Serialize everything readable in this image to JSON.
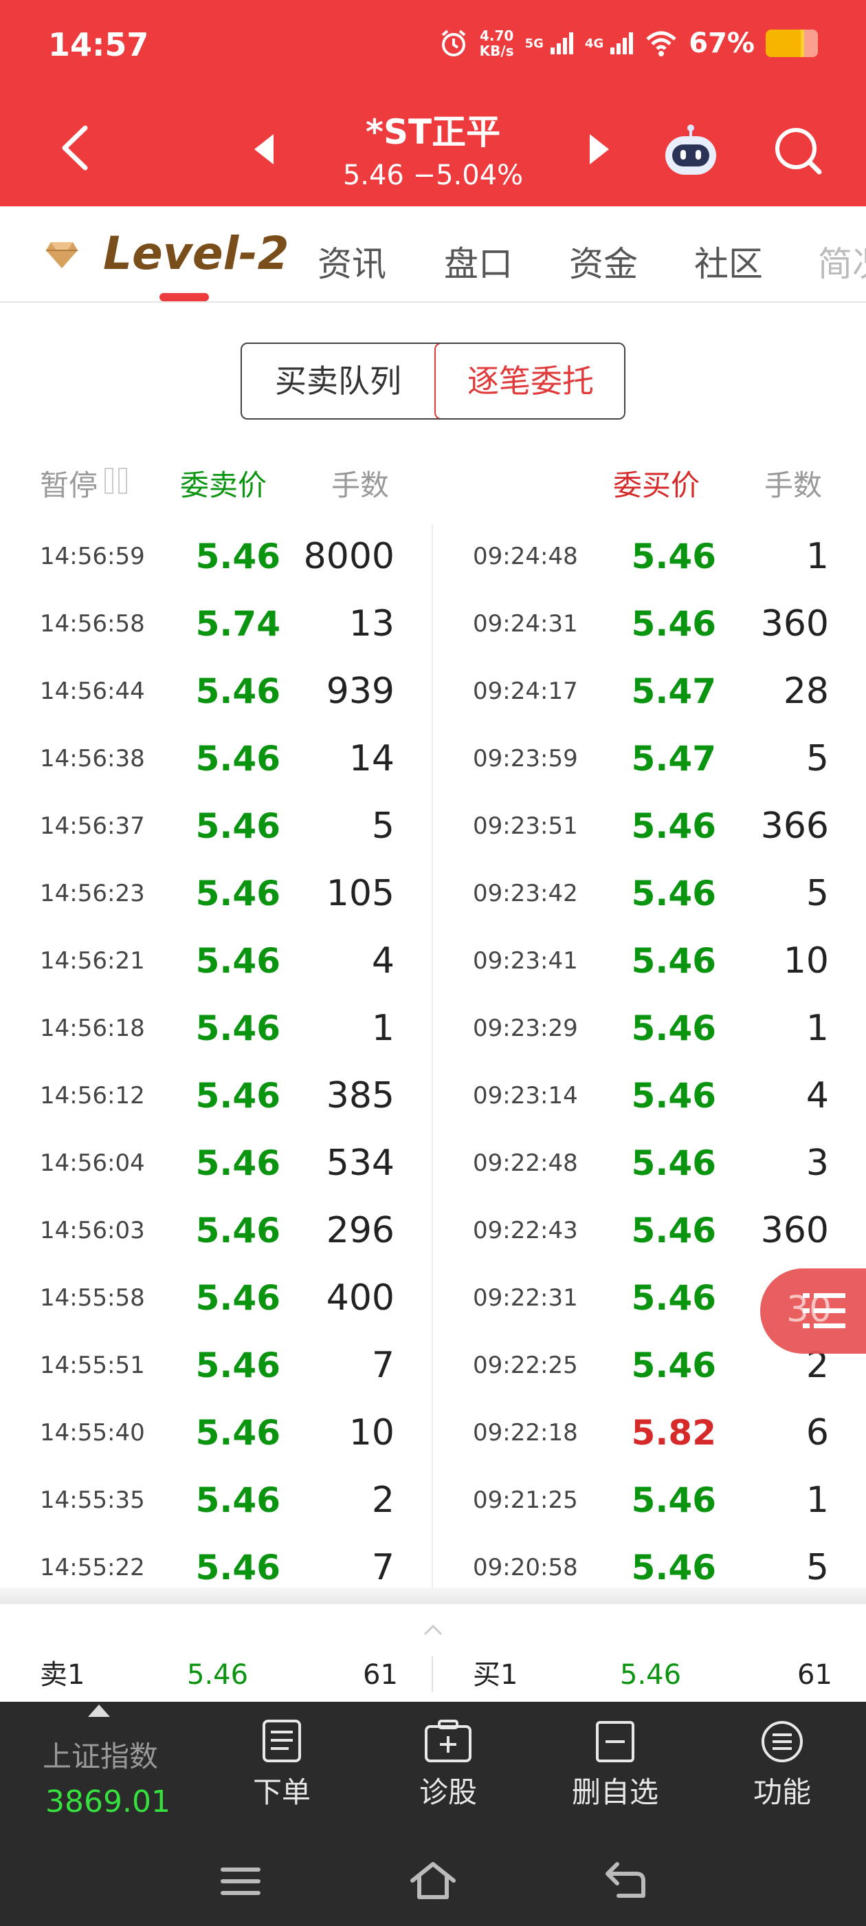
{
  "status_bar": {
    "time": "14:57",
    "speed_value": "4.70",
    "speed_unit": "KB/s",
    "net1": "5G",
    "net2": "4G",
    "battery": "67%",
    "battery_level": 0.67
  },
  "header": {
    "stock_name": "*ST正平",
    "quote": "5.46 −5.04%"
  },
  "tabs": {
    "level2": "Level-2",
    "items": [
      "资讯",
      "盘口",
      "资金",
      "社区",
      "简况"
    ]
  },
  "segment": {
    "left": "买卖队列",
    "right": "逐笔委托"
  },
  "columns": {
    "pause": "暂停",
    "sell_price": "委卖价",
    "sell_qty": "手数",
    "buy_price": "委买价",
    "buy_qty": "手数"
  },
  "sell_rows": [
    {
      "time": "14:56:59",
      "price": "5.46",
      "qty": "8000",
      "color": "green"
    },
    {
      "time": "14:56:58",
      "price": "5.74",
      "qty": "13",
      "color": "green"
    },
    {
      "time": "14:56:44",
      "price": "5.46",
      "qty": "939",
      "color": "green"
    },
    {
      "time": "14:56:38",
      "price": "5.46",
      "qty": "14",
      "color": "green"
    },
    {
      "time": "14:56:37",
      "price": "5.46",
      "qty": "5",
      "color": "green"
    },
    {
      "time": "14:56:23",
      "price": "5.46",
      "qty": "105",
      "color": "green"
    },
    {
      "time": "14:56:21",
      "price": "5.46",
      "qty": "4",
      "color": "green"
    },
    {
      "time": "14:56:18",
      "price": "5.46",
      "qty": "1",
      "color": "green"
    },
    {
      "time": "14:56:12",
      "price": "5.46",
      "qty": "385",
      "color": "green"
    },
    {
      "time": "14:56:04",
      "price": "5.46",
      "qty": "534",
      "color": "green"
    },
    {
      "time": "14:56:03",
      "price": "5.46",
      "qty": "296",
      "color": "green"
    },
    {
      "time": "14:55:58",
      "price": "5.46",
      "qty": "400",
      "color": "green"
    },
    {
      "time": "14:55:51",
      "price": "5.46",
      "qty": "7",
      "color": "green"
    },
    {
      "time": "14:55:40",
      "price": "5.46",
      "qty": "10",
      "color": "green"
    },
    {
      "time": "14:55:35",
      "price": "5.46",
      "qty": "2",
      "color": "green"
    },
    {
      "time": "14:55:22",
      "price": "5.46",
      "qty": "7",
      "color": "green"
    }
  ],
  "buy_rows": [
    {
      "time": "09:24:48",
      "price": "5.46",
      "qty": "1",
      "color": "green"
    },
    {
      "time": "09:24:31",
      "price": "5.46",
      "qty": "360",
      "color": "green"
    },
    {
      "time": "09:24:17",
      "price": "5.47",
      "qty": "28",
      "color": "green"
    },
    {
      "time": "09:23:59",
      "price": "5.47",
      "qty": "5",
      "color": "green"
    },
    {
      "time": "09:23:51",
      "price": "5.46",
      "qty": "366",
      "color": "green"
    },
    {
      "time": "09:23:42",
      "price": "5.46",
      "qty": "5",
      "color": "green"
    },
    {
      "time": "09:23:41",
      "price": "5.46",
      "qty": "10",
      "color": "green"
    },
    {
      "time": "09:23:29",
      "price": "5.46",
      "qty": "1",
      "color": "green"
    },
    {
      "time": "09:23:14",
      "price": "5.46",
      "qty": "4",
      "color": "green"
    },
    {
      "time": "09:22:48",
      "price": "5.46",
      "qty": "3",
      "color": "green"
    },
    {
      "time": "09:22:43",
      "price": "5.46",
      "qty": "360",
      "color": "green"
    },
    {
      "time": "09:22:31",
      "price": "5.46",
      "qty": "",
      "color": "green"
    },
    {
      "time": "09:22:25",
      "price": "5.46",
      "qty": "2",
      "color": "green"
    },
    {
      "time": "09:22:18",
      "price": "5.82",
      "qty": "6",
      "color": "red"
    },
    {
      "time": "09:21:25",
      "price": "5.46",
      "qty": "1",
      "color": "green"
    },
    {
      "time": "09:20:58",
      "price": "5.46",
      "qty": "5",
      "color": "green"
    }
  ],
  "float_button": {
    "peek_text": "30"
  },
  "best_quotes": {
    "sell_label": "卖1",
    "sell_price": "5.46",
    "sell_qty": "61",
    "buy_label": "买1",
    "buy_price": "5.46",
    "buy_qty": "61"
  },
  "toolbar": {
    "index_name": "上证指数",
    "index_value": "3869.01",
    "items": [
      "下单",
      "诊股",
      "删自选",
      "功能"
    ]
  },
  "colors": {
    "header_red": "#ee3b3d",
    "price_green": "#0b9410",
    "price_red": "#d62a2a",
    "accent_red": "#e03a3a",
    "index_green": "#36e03e"
  }
}
